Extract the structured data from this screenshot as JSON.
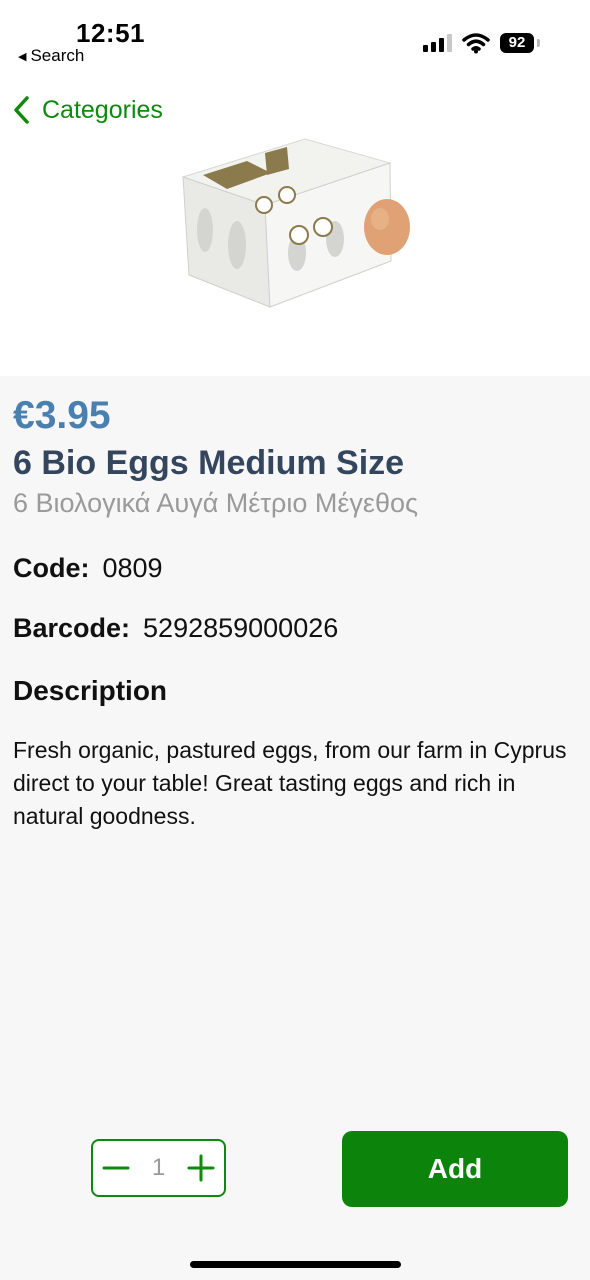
{
  "status_bar": {
    "time": "12:51",
    "back_app": "Search",
    "battery": "92"
  },
  "nav": {
    "back_label": "Categories"
  },
  "product": {
    "image_icon": "egg-carton-image",
    "price": "€3.95",
    "name": "6 Bio Eggs Medium Size",
    "name_greek": "6 Βιολογικά Αυγά Μέτριο Μέγεθος",
    "code_label": "Code:",
    "code": "0809",
    "barcode_label": "Barcode:",
    "barcode": "5292859000026",
    "description_heading": "Description",
    "description": "Fresh organic, pastured eggs, from our farm in Cyprus direct to your table! Great tasting eggs and rich in natural goodness."
  },
  "cart": {
    "quantity": "1",
    "add_label": "Add"
  },
  "colors": {
    "accent_green": "#0c840c",
    "price_blue": "#4a80b0",
    "title_navy": "#34465e"
  }
}
